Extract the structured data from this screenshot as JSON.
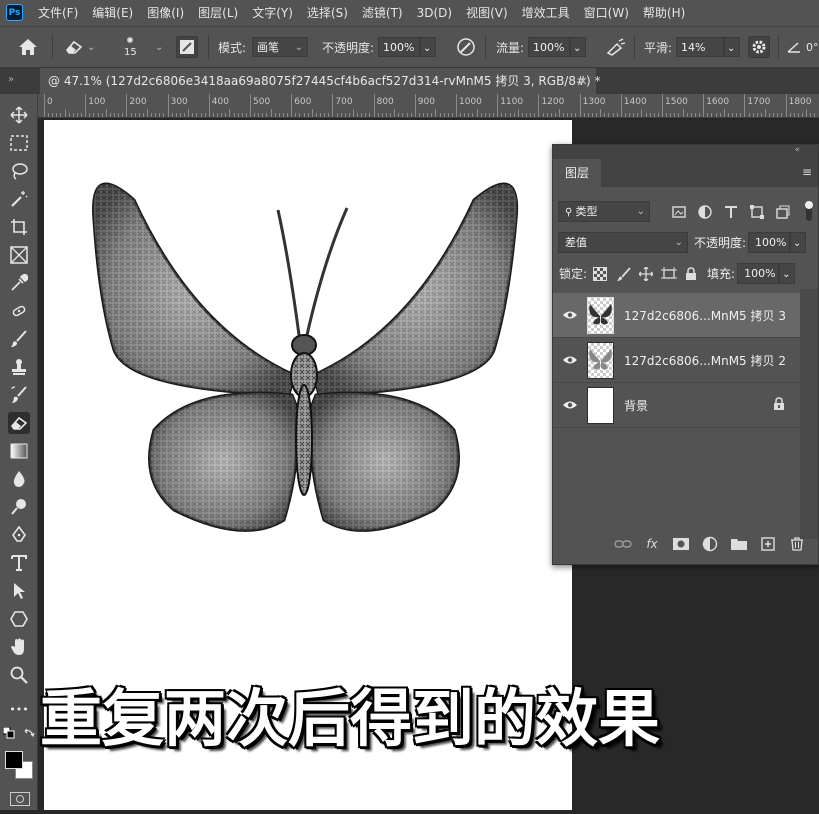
{
  "app": {
    "logo_text": "Ps",
    "menu": [
      "文件(F)",
      "编辑(E)",
      "图像(I)",
      "图层(L)",
      "文字(Y)",
      "选择(S)",
      "滤镜(T)",
      "3D(D)",
      "视图(V)",
      "增效工具",
      "窗口(W)",
      "帮助(H)"
    ]
  },
  "options": {
    "brush_size": "15",
    "mode_label": "模式:",
    "mode_value": "画笔",
    "opacity_label": "不透明度:",
    "opacity_value": "100%",
    "flow_label": "流量:",
    "flow_value": "100%",
    "smooth_label": "平滑:",
    "smooth_value": "14%",
    "angle_value": "0°"
  },
  "document_tab": {
    "collapse": "»",
    "title": "@ 47.1% (127d2c6806e3418aa69a8075f27445cf4b6acf527d314-rvMnM5 拷贝 3, RGB/8#) *",
    "close": "×"
  },
  "ruler": {
    "labels": [
      "0",
      "100",
      "200",
      "300",
      "400",
      "500",
      "600",
      "700",
      "800",
      "900",
      "1000",
      "1100",
      "1200",
      "1300",
      "1400",
      "1500",
      "1600",
      "1700",
      "1800"
    ]
  },
  "toolbar": {
    "tools": [
      "move-tool",
      "marquee-tool",
      "lasso-tool",
      "magic-wand-tool",
      "crop-tool",
      "frame-tool",
      "eyedropper-tool",
      "healing-tool",
      "brush-tool",
      "stamp-tool",
      "history-brush-tool",
      "eraser-tool",
      "gradient-tool",
      "blur-tool",
      "dodge-tool",
      "pen-tool",
      "type-tool",
      "path-select-tool",
      "shape-tool",
      "hand-tool",
      "zoom-tool",
      "more-tools"
    ],
    "active_tool": "eraser-tool",
    "more_label": "•••"
  },
  "layers_panel": {
    "collapse": "«",
    "tab_label": "图层",
    "menu_icon": "≡",
    "filter_label": "类型",
    "blend_mode": "差值",
    "opacity_label": "不透明度:",
    "opacity_value": "100%",
    "lock_label": "锁定:",
    "fill_label": "填充:",
    "fill_value": "100%",
    "layers": [
      {
        "name": "127d2c6806...MnM5 拷贝 3",
        "selected": true,
        "thumb": "butterfly-dark"
      },
      {
        "name": "127d2c6806...MnM5 拷贝 2",
        "selected": false,
        "thumb": "butterfly-light"
      },
      {
        "name": "背景",
        "selected": false,
        "thumb": "white",
        "locked": true
      }
    ],
    "bottom_fx": "fx"
  },
  "caption": "重复两次后得到的效果",
  "colors": {
    "foreground": "#000000",
    "background": "#ffffff",
    "ui_panel": "#535353",
    "ui_dark": "#282828",
    "selected_layer": "#686868"
  }
}
